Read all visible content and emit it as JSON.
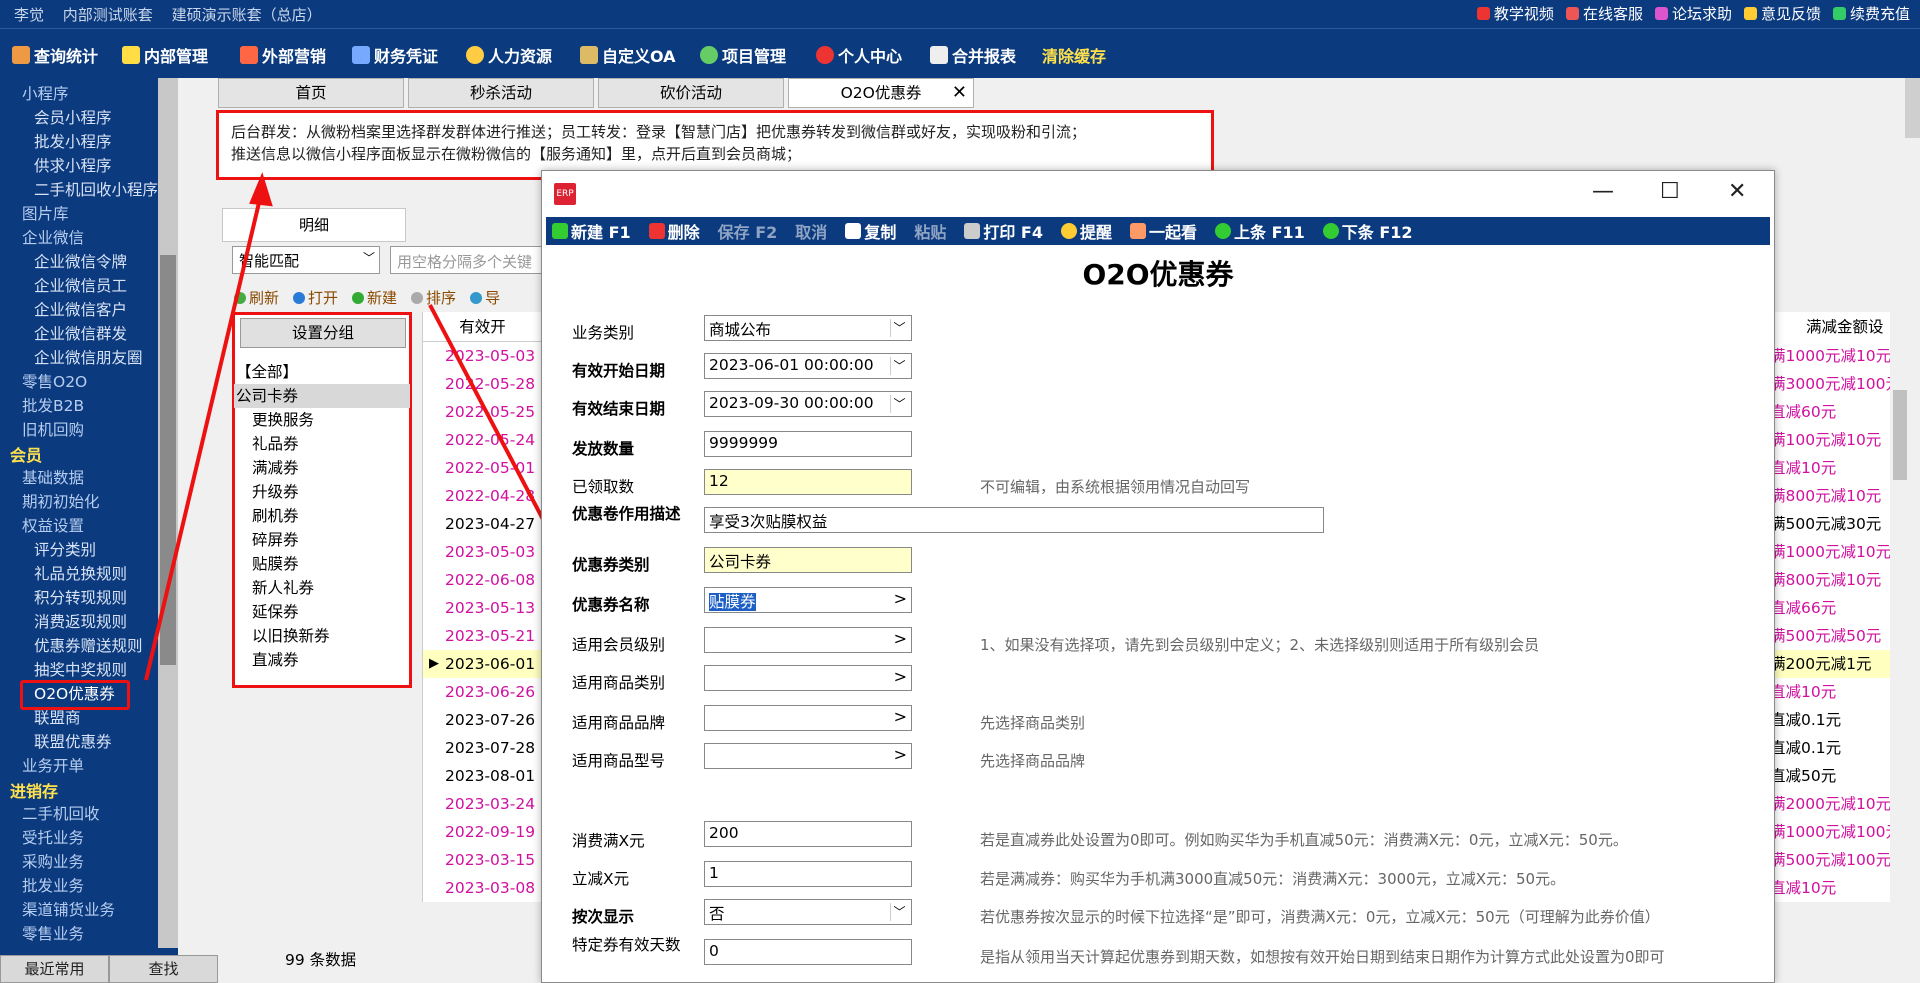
{
  "topbar": {
    "user": "李觉",
    "account_test": "内部测试账套",
    "account_demo": "建硕演示账套（总店）",
    "links": [
      "教学视频",
      "在线客服",
      "论坛求助",
      "意见反馈",
      "续费充值"
    ]
  },
  "menu": {
    "items": [
      "查询统计",
      "内部管理",
      "外部营销",
      "财务凭证",
      "人力资源",
      "自定义OA",
      "项目管理",
      "个人中心",
      "合并报表",
      "清除缓存"
    ]
  },
  "sidebar": {
    "items": [
      {
        "label": "小程序",
        "level": 1
      },
      {
        "label": "会员小程序",
        "level": 2
      },
      {
        "label": "批发小程序",
        "level": 2
      },
      {
        "label": "供求小程序",
        "level": 2
      },
      {
        "label": "二手机回收小程序",
        "level": 2
      },
      {
        "label": "图片库",
        "level": 1
      },
      {
        "label": "企业微信",
        "level": 1
      },
      {
        "label": "企业微信令牌",
        "level": 2
      },
      {
        "label": "企业微信员工",
        "level": 2
      },
      {
        "label": "企业微信客户",
        "level": 2
      },
      {
        "label": "企业微信群发",
        "level": 2
      },
      {
        "label": "企业微信朋友圈",
        "level": 2
      },
      {
        "label": "零售O2O",
        "level": 1
      },
      {
        "label": "批发B2B",
        "level": 1
      },
      {
        "label": "旧机回购",
        "level": 1
      },
      {
        "label": "会员",
        "level": 0
      },
      {
        "label": "基础数据",
        "level": 1
      },
      {
        "label": "期初初始化",
        "level": 1
      },
      {
        "label": "权益设置",
        "level": 1
      },
      {
        "label": "评分类别",
        "level": 2
      },
      {
        "label": "礼品兑换规则",
        "level": 2
      },
      {
        "label": "积分转现规则",
        "level": 2
      },
      {
        "label": "消费返现规则",
        "level": 2
      },
      {
        "label": "优惠券赠送规则",
        "level": 2
      },
      {
        "label": "抽奖中奖规则",
        "level": 2
      },
      {
        "label": "O2O优惠券",
        "level": 2
      },
      {
        "label": "联盟商",
        "level": 2
      },
      {
        "label": "联盟优惠券",
        "level": 2
      },
      {
        "label": "业务开单",
        "level": 1
      },
      {
        "label": "进销存",
        "level": 0
      },
      {
        "label": "二手机回收",
        "level": 1
      },
      {
        "label": "受托业务",
        "level": 1
      },
      {
        "label": "采购业务",
        "level": 1
      },
      {
        "label": "批发业务",
        "level": 1
      },
      {
        "label": "渠道铺货业务",
        "level": 1
      },
      {
        "label": "零售业务",
        "level": 1
      }
    ],
    "bottom": [
      "最近常用",
      "查找"
    ]
  },
  "tabs": [
    "首页",
    "秒杀活动",
    "砍价活动",
    "O2O优惠券"
  ],
  "notice": {
    "line1": "后台群发：从微粉档案里选择群发群体进行推送；员工转发：登录【智慧门店】把优惠券转发到微信群或好友，实现吸粉和引流；",
    "line2": "推送信息以微信小程序面板显示在微粉微信的【服务通知】里，点开后直到会员商城；"
  },
  "list": {
    "subtab": "明细",
    "match": "智能匹配",
    "search_placeholder": "用空格分隔多个关键",
    "actions": [
      "刷新",
      "打开",
      "新建",
      "排序",
      "导"
    ],
    "group_button": "设置分组",
    "groups": [
      "【全部】",
      "公司卡券",
      "更换服务",
      "礼品券",
      "满减券",
      "升级券",
      "刷机券",
      "碎屏券",
      "贴膜券",
      "新人礼券",
      "延保券",
      "以旧换新券",
      "直减券"
    ],
    "count": "99 条数据",
    "col_date": "有效开",
    "col_rule": "满减金额设",
    "rows": [
      {
        "date": "2023-05-03 0",
        "rule": "满1000元减10元",
        "pink": true
      },
      {
        "date": "2022-05-28 0",
        "rule": "满3000元减100元",
        "pink": true
      },
      {
        "date": "2022-05-25 0",
        "rule": "直减60元",
        "pink": true
      },
      {
        "date": "2022-05-24 0",
        "rule": "满100元减10元",
        "pink": true
      },
      {
        "date": "2022-05-01 0",
        "rule": "直减10元",
        "pink": true
      },
      {
        "date": "2022-04-28 0",
        "rule": "满800元减10元",
        "pink": true
      },
      {
        "date": "2023-04-27 0",
        "rule": "满500元减30元",
        "pink": false
      },
      {
        "date": "2023-05-03 0",
        "rule": "满1000元减10元",
        "pink": true
      },
      {
        "date": "2022-06-08 0",
        "rule": "满800元减10元",
        "pink": true
      },
      {
        "date": "2023-05-13 0",
        "rule": "直减66元",
        "pink": true
      },
      {
        "date": "2023-05-21 0",
        "rule": "满500元减50元",
        "pink": true
      },
      {
        "date": "2023-06-01 0",
        "rule": "满200元减1元",
        "pink": false,
        "current": true
      },
      {
        "date": "2023-06-26 0",
        "rule": "直减10元",
        "pink": true
      },
      {
        "date": "2023-07-26 0",
        "rule": "直减0.1元",
        "pink": false
      },
      {
        "date": "2023-07-28 0",
        "rule": "直减0.1元",
        "pink": false
      },
      {
        "date": "2023-08-01 0",
        "rule": "直减50元",
        "pink": false
      },
      {
        "date": "2023-03-24 0",
        "rule": "满2000元减10元",
        "pink": true
      },
      {
        "date": "2022-09-19 0",
        "rule": "满1000元减100元",
        "pink": true
      },
      {
        "date": "2023-03-15 0",
        "rule": "满500元减100元",
        "pink": true
      },
      {
        "date": "2023-03-08 0",
        "rule": "直减10元",
        "pink": true
      }
    ]
  },
  "dialog": {
    "title": "O2O优惠券",
    "toolbar": [
      "新建 F1",
      "删除",
      "保存 F2",
      "取消",
      "复制",
      "粘贴",
      "打印 F4",
      "提醒",
      "一起看",
      "上条 F11",
      "下条 F12"
    ],
    "fields": {
      "biz_type": {
        "label": "业务类别",
        "value": "商城公布"
      },
      "start": {
        "label": "有效开始日期",
        "value": "2023-06-01 00:00:00"
      },
      "end": {
        "label": "有效结束日期",
        "value": "2023-09-30 00:00:00"
      },
      "qty": {
        "label": "发放数量",
        "value": "9999999"
      },
      "received": {
        "label": "已领取数",
        "value": "12",
        "hint": "不可编辑，由系统根据领用情况自动回写"
      },
      "desc": {
        "label": "优惠卷作用描述",
        "value": "享受3次贴膜权益"
      },
      "category": {
        "label": "优惠券类别",
        "value": "公司卡券"
      },
      "name": {
        "label": "优惠券名称",
        "value": "贴膜券"
      },
      "member_level": {
        "label": "适用会员级别",
        "value": "",
        "hint": "1、如果没有选择项，请先到会员级别中定义；2、未选择级别则适用于所有级别会员"
      },
      "goods_cat": {
        "label": "适用商品类别",
        "value": ""
      },
      "goods_brand": {
        "label": "适用商品品牌",
        "value": "",
        "hint": "先选择商品类别"
      },
      "goods_model": {
        "label": "适用商品型号",
        "value": "",
        "hint": "先选择商品品牌"
      },
      "spend": {
        "label": "消费满X元",
        "value": "200",
        "hint": "若是直减券此处设置为0即可。例如购买华为手机直减50元：消费满X元：0元，立减X元：50元。"
      },
      "minus": {
        "label": "立减X元",
        "value": "1",
        "hint": "若是满减券：购买华为手机满3000直减50元：消费满X元：3000元，立减X元：50元。"
      },
      "by_times": {
        "label": "按次显示",
        "value": "否",
        "hint": "若优惠券按次显示的时候下拉选择“是”即可，消费满X元：0元，立减X元：50元（可理解为此券价值）"
      },
      "days": {
        "label": "特定券有效天数",
        "value": "0",
        "hint": "是指从领用当天计算起优惠券到期天数，如想按有效开始日期到结束日期作为计算方式此处设置为0即可"
      }
    }
  }
}
